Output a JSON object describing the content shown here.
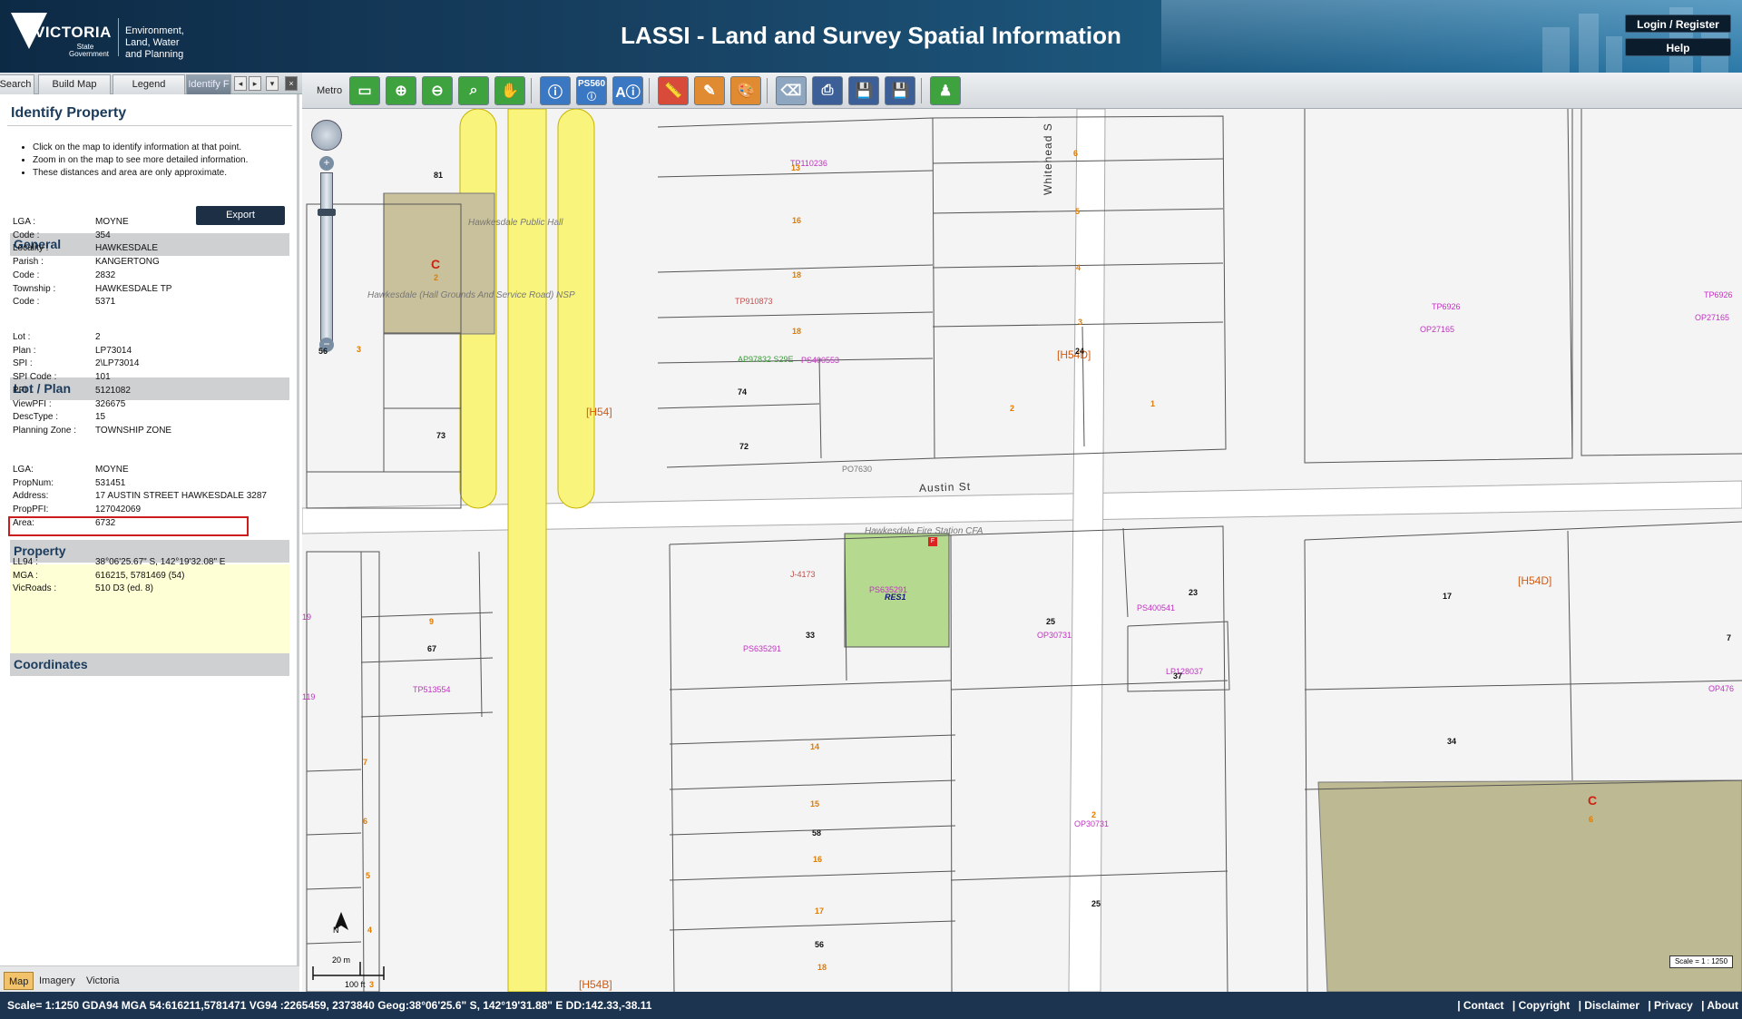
{
  "header": {
    "logo_word": "VICTORIA",
    "logo_sub": "State Government",
    "department": [
      "Environment,",
      "Land, Water",
      "and Planning"
    ],
    "title": "LASSI - Land and Survey Spatial Information",
    "login_label": "Login / Register",
    "help_label": "Help"
  },
  "tabs": [
    "Search",
    "Build Map",
    "Legend",
    "Identify F"
  ],
  "panel": {
    "title": "Identify Property",
    "bullets": [
      "Click on the map to identify information at that point.",
      "Zoom in on the map to see more detailed information.",
      "These distances and area are only approximate."
    ],
    "export_label": "Export",
    "general_title": "General",
    "general": [
      {
        "k": "LGA :",
        "v": "MOYNE"
      },
      {
        "k": "Code :",
        "v": "354"
      },
      {
        "k": "Locality :",
        "v": "HAWKESDALE"
      },
      {
        "k": "Parish :",
        "v": "KANGERTONG"
      },
      {
        "k": "Code :",
        "v": "2832"
      },
      {
        "k": "Township :",
        "v": "HAWKESDALE TP"
      },
      {
        "k": "Code :",
        "v": "5371"
      }
    ],
    "lot_title": "Lot / Plan",
    "lot": [
      {
        "k": "Lot :",
        "v": "2"
      },
      {
        "k": "Plan :",
        "v": "LP73014"
      },
      {
        "k": "SPI :",
        "v": "2\\LP73014"
      },
      {
        "k": "SPI Code :",
        "v": "101"
      },
      {
        "k": "PFI :",
        "v": "5121082"
      },
      {
        "k": "ViewPFI :",
        "v": "326675"
      },
      {
        "k": "DescType :",
        "v": "15"
      },
      {
        "k": "Planning Zone :",
        "v": "TOWNSHIP ZONE"
      }
    ],
    "property_title": "Property",
    "property": [
      {
        "k": "LGA:",
        "v": "MOYNE"
      },
      {
        "k": "PropNum:",
        "v": "531451"
      },
      {
        "k": "Address:",
        "v": "17 AUSTIN STREET HAWKESDALE 3287"
      },
      {
        "k": "PropPFI:",
        "v": "127042069"
      },
      {
        "k": "Area:",
        "v": "6732"
      }
    ],
    "coords_title": "Coordinates",
    "coords": [
      {
        "k": "LL94 :",
        "v": "38°06'25.67\" S, 142°19'32.08\" E"
      },
      {
        "k": "MGA :",
        "v": "616215, 5781469 (54)"
      },
      {
        "k": "VicRoads :",
        "v": "510 D3 (ed. 8)"
      }
    ]
  },
  "bottom_tabs": [
    "Map",
    "Imagery",
    "Victoria"
  ],
  "toolbar": {
    "metro_label": "Metro",
    "ps560_label": "PS560"
  },
  "map": {
    "street_austin": "Austin St",
    "street_whitehead": "Whitehead S",
    "public_hall": "Hawkesdale Public Hall",
    "hall_grounds": "Hawkesdale (Hall Grounds And Service Road) NSP",
    "fire_station": "Hawkesdale Fire Station CFA",
    "res1": "RES1",
    "north": "N",
    "scale_m": "20 m",
    "scale_ft": "100 ft",
    "scale_ratio": "Scale = 1 : 1250"
  },
  "status": {
    "text": "Scale= 1:1250 GDA94 MGA 54:616211,5781471 VG94 :2265459, 2373840 Geog:38°06'25.6\" S, 142°19'31.88\" E DD:142.33,-38.11",
    "links": [
      "| Contact",
      "| Copyright",
      "| Disclaimer",
      "| Privacy",
      "| About"
    ]
  },
  "colors": {
    "header_dark": "#0d2a45",
    "status_bg": "#1c344f",
    "road_yellow": "#f9f57c",
    "park_green": "#b5d98f",
    "reserve_tan": "#c9c19b",
    "highlight_red": "#cc1d1d"
  }
}
